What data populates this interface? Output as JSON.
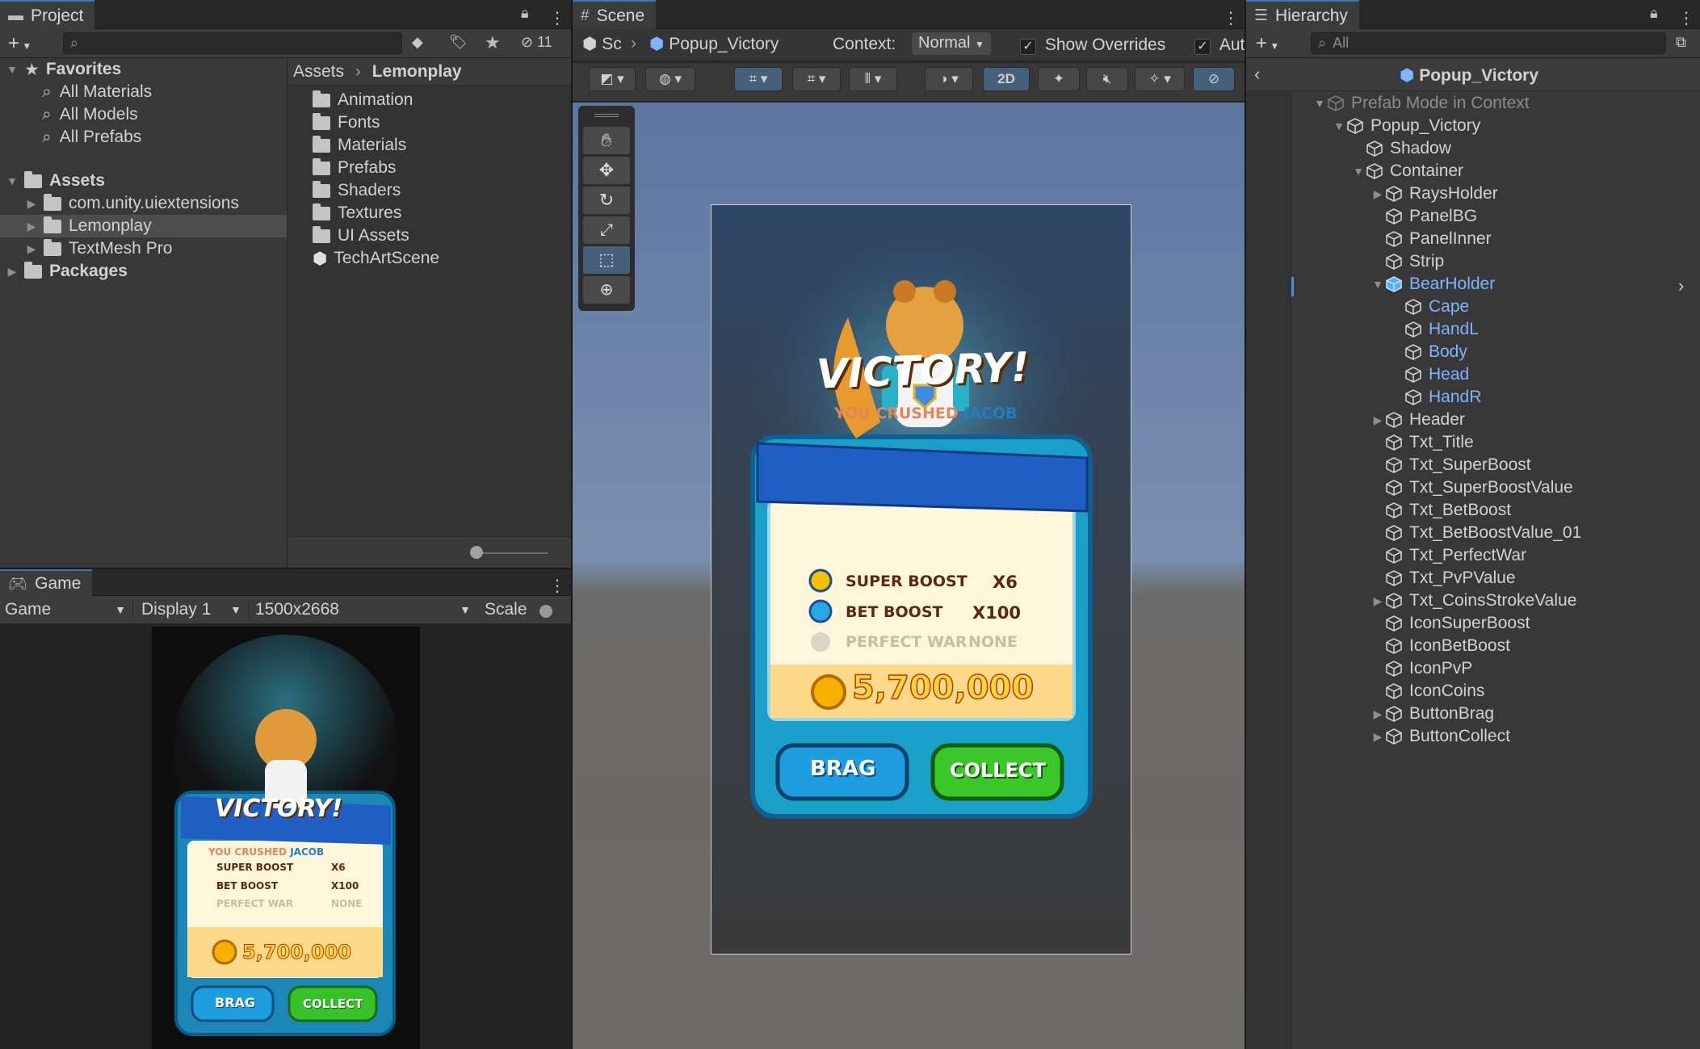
{
  "project": {
    "tab_label": "Project",
    "hidden_count": "11",
    "favorites": {
      "label": "Favorites",
      "items": [
        "All Materials",
        "All Models",
        "All Prefabs"
      ]
    },
    "assets": {
      "label": "Assets",
      "items": [
        "com.unity.uiextensions",
        "Lemonplay",
        "TextMesh Pro"
      ]
    },
    "packages_label": "Packages",
    "breadcrumb": {
      "root": "Assets",
      "current": "Lemonplay"
    },
    "contents": [
      "Animation",
      "Fonts",
      "Materials",
      "Prefabs",
      "Shaders",
      "Textures",
      "UI Assets",
      "TechArtScene"
    ]
  },
  "game": {
    "tab_label": "Game",
    "mode": "Game",
    "display": "Display 1",
    "resolution": "1500x2668",
    "scale_label": "Scale"
  },
  "scene": {
    "tab_label": "Scene",
    "breadcrumb_root": "Sc",
    "prefab_name": "Popup_Victory",
    "context_label": "Context:",
    "context_value": "Normal",
    "show_overrides": "Show Overrides",
    "auto_label": "Aut",
    "mode_2d": "2D"
  },
  "popup": {
    "title": "VICTORY!",
    "crushed_prefix": "YOU CRUSHED",
    "crushed_name": "JACOB",
    "rows": [
      {
        "label": "SUPER BOOST",
        "value": "X6"
      },
      {
        "label": "BET BOOST",
        "value": "X100"
      },
      {
        "label": "PERFECT WAR",
        "value": "NONE"
      }
    ],
    "coins": "5,700,000",
    "brag": "BRAG",
    "collect": "COLLECT"
  },
  "hierarchy": {
    "tab_label": "Hierarchy",
    "search_placeholder": "All",
    "header": "Popup_Victory",
    "items": [
      {
        "label": "Prefab Mode in Context",
        "depth": 0,
        "arrow": "open",
        "style": "gray"
      },
      {
        "label": "Popup_Victory",
        "depth": 1,
        "arrow": "open",
        "style": "normal"
      },
      {
        "label": "Shadow",
        "depth": 2,
        "arrow": "",
        "style": "normal"
      },
      {
        "label": "Container",
        "depth": 2,
        "arrow": "open",
        "style": "normal"
      },
      {
        "label": "RaysHolder",
        "depth": 3,
        "arrow": "closed",
        "style": "normal"
      },
      {
        "label": "PanelBG",
        "depth": 3,
        "arrow": "",
        "style": "normal"
      },
      {
        "label": "PanelInner",
        "depth": 3,
        "arrow": "",
        "style": "normal"
      },
      {
        "label": "Strip",
        "depth": 3,
        "arrow": "",
        "style": "normal"
      },
      {
        "label": "BearHolder",
        "depth": 3,
        "arrow": "open",
        "style": "prefab"
      },
      {
        "label": "Cape",
        "depth": 4,
        "arrow": "",
        "style": "blue"
      },
      {
        "label": "HandL",
        "depth": 4,
        "arrow": "",
        "style": "blue"
      },
      {
        "label": "Body",
        "depth": 4,
        "arrow": "",
        "style": "blue"
      },
      {
        "label": "Head",
        "depth": 4,
        "arrow": "",
        "style": "blue"
      },
      {
        "label": "HandR",
        "depth": 4,
        "arrow": "",
        "style": "blue"
      },
      {
        "label": "Header",
        "depth": 3,
        "arrow": "closed",
        "style": "normal"
      },
      {
        "label": "Txt_Title",
        "depth": 3,
        "arrow": "",
        "style": "normal"
      },
      {
        "label": "Txt_SuperBoost",
        "depth": 3,
        "arrow": "",
        "style": "normal"
      },
      {
        "label": "Txt_SuperBoostValue",
        "depth": 3,
        "arrow": "",
        "style": "normal"
      },
      {
        "label": "Txt_BetBoost",
        "depth": 3,
        "arrow": "",
        "style": "normal"
      },
      {
        "label": "Txt_BetBoostValue_01",
        "depth": 3,
        "arrow": "",
        "style": "normal"
      },
      {
        "label": "Txt_PerfectWar",
        "depth": 3,
        "arrow": "",
        "style": "normal"
      },
      {
        "label": "Txt_PvPValue",
        "depth": 3,
        "arrow": "",
        "style": "normal"
      },
      {
        "label": "Txt_CoinsStrokeValue",
        "depth": 3,
        "arrow": "closed",
        "style": "normal"
      },
      {
        "label": "IconSuperBoost",
        "depth": 3,
        "arrow": "",
        "style": "normal"
      },
      {
        "label": "IconBetBoost",
        "depth": 3,
        "arrow": "",
        "style": "normal"
      },
      {
        "label": "IconPvP",
        "depth": 3,
        "arrow": "",
        "style": "normal"
      },
      {
        "label": "IconCoins",
        "depth": 3,
        "arrow": "",
        "style": "normal"
      },
      {
        "label": "ButtonBrag",
        "depth": 3,
        "arrow": "closed",
        "style": "normal"
      },
      {
        "label": "ButtonCollect",
        "depth": 3,
        "arrow": "closed",
        "style": "normal"
      }
    ]
  },
  "colors": {
    "selection": "#4d4d4d",
    "accent_tab": "#3a79bb",
    "prefab_blue": "#7fb4ff"
  }
}
